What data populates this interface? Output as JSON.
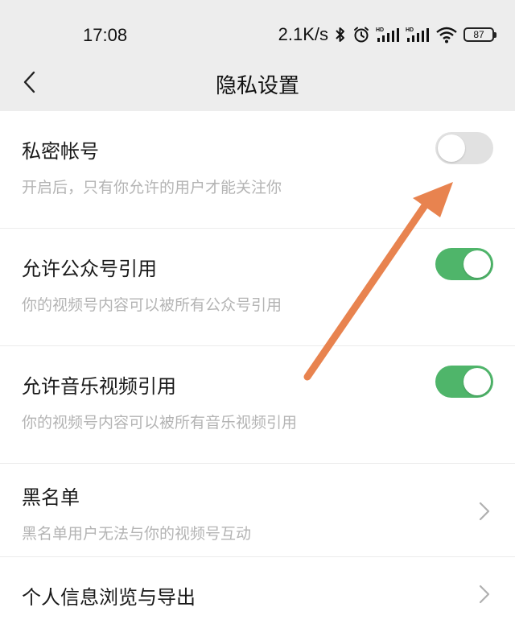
{
  "status_bar": {
    "time": "17:08",
    "net_speed": "2.1K/s",
    "battery_level": "87",
    "icons": [
      "bluetooth-icon",
      "alarm-icon",
      "hd-signal-icon",
      "hd-signal-icon",
      "wifi-icon",
      "battery-icon"
    ]
  },
  "nav": {
    "back_icon": "chevron-left-icon",
    "title": "隐私设置"
  },
  "settings": [
    {
      "title": "私密帐号",
      "description": "开启后，只有你允许的用户才能关注你",
      "control": "toggle",
      "enabled": false
    },
    {
      "title": "允许公众号引用",
      "description": "你的视频号内容可以被所有公众号引用",
      "control": "toggle",
      "enabled": true
    },
    {
      "title": "允许音乐视频引用",
      "description": "你的视频号内容可以被所有音乐视频引用",
      "control": "toggle",
      "enabled": true
    },
    {
      "title": "黑名单",
      "description": "黑名单用户无法与你的视频号互动",
      "control": "chevron"
    },
    {
      "title": "个人信息浏览与导出",
      "control": "chevron"
    }
  ],
  "colors": {
    "toggle_on": "#4fb56a",
    "toggle_off": "#e1e1e1",
    "annotation_arrow": "#e8834f",
    "header_bg": "#ededed"
  }
}
